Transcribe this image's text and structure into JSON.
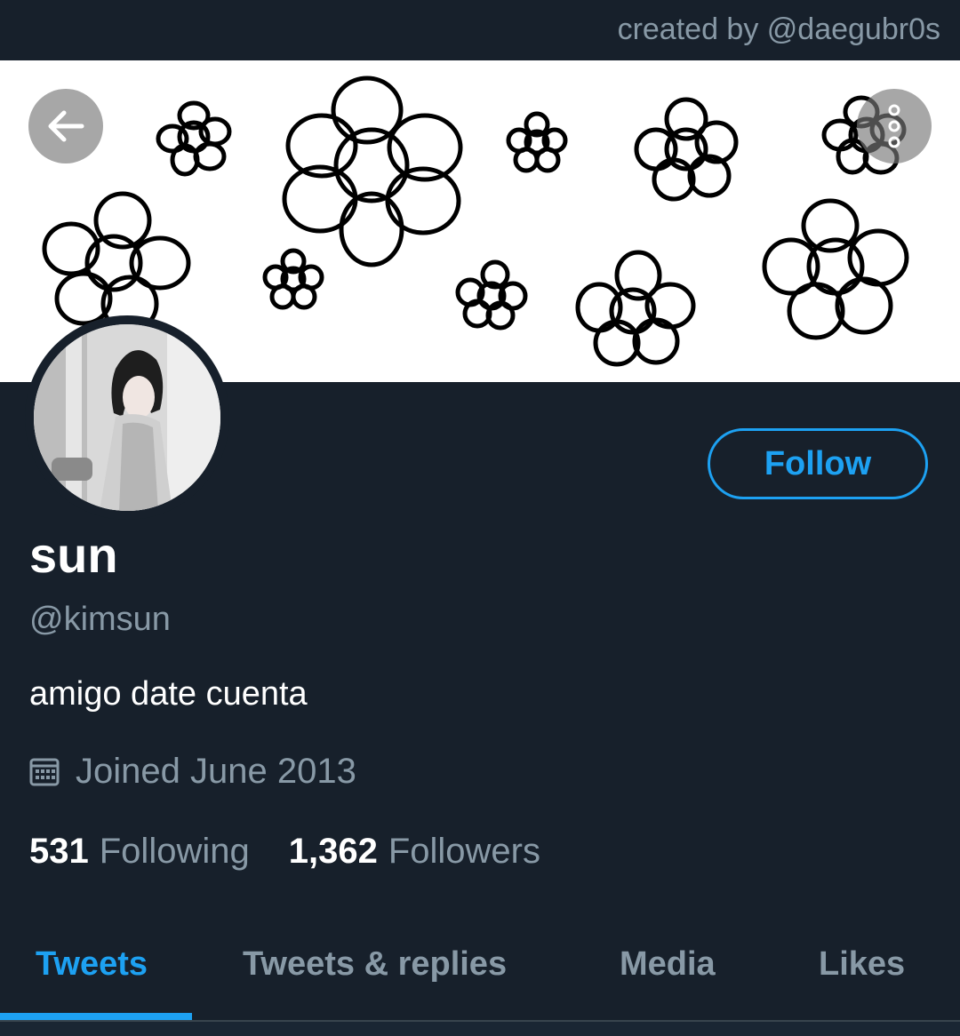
{
  "credit": "created by @daegubr0s",
  "profile": {
    "name": "sun",
    "handle": "@kimsun",
    "bio": "amigo date cuenta",
    "joined": "Joined June 2013",
    "follow_label": "Follow"
  },
  "stats": {
    "following_count": "531",
    "following_label": "Following",
    "followers_count": "1,362",
    "followers_label": "Followers"
  },
  "tabs": [
    {
      "label": "Tweets",
      "active": true
    },
    {
      "label": "Tweets & replies",
      "active": false
    },
    {
      "label": "Media",
      "active": false
    },
    {
      "label": "Likes",
      "active": false
    }
  ],
  "icons": {
    "back": "back-arrow-icon",
    "more": "more-vertical-icon",
    "calendar": "calendar-icon"
  },
  "colors": {
    "background": "#17202b",
    "accent": "#1da1f2",
    "muted": "#8899a6",
    "text": "#ffffff"
  }
}
